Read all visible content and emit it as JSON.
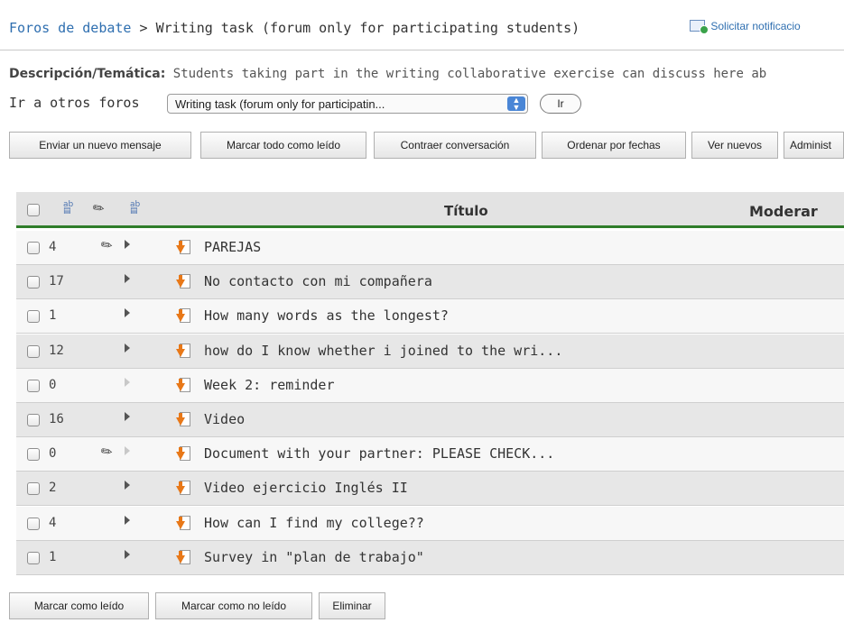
{
  "breadcrumb": {
    "forums_link": "Foros de debate",
    "separator": ">",
    "current": "Writing task (forum only for participating students)"
  },
  "notify": {
    "label": "Solicitar notificacio",
    "icon": "envelope-icon"
  },
  "description": {
    "label": "Descripción/Temática:",
    "text": "Students taking part in the writing collaborative exercise can discuss here ab"
  },
  "goto": {
    "label": "Ir a otros foros",
    "selected": "Writing task (forum only for participatin...",
    "go_button": "Ir"
  },
  "actions": [
    "Enviar un nuevo mensaje",
    "Marcar todo como leído",
    "Contraer conversación",
    "Ordenar por fechas",
    "Ver nuevos",
    "Administ"
  ],
  "table": {
    "col_title": "Título",
    "col_moderate": "Moderar",
    "rows": [
      {
        "count": "4",
        "attachment": true,
        "title": "PAREJAS",
        "arrow_active": true
      },
      {
        "count": "17",
        "attachment": false,
        "title": "No contacto con mi compañera",
        "arrow_active": true
      },
      {
        "count": "1",
        "attachment": false,
        "title": "How many words as the longest?",
        "arrow_active": true
      },
      {
        "count": "12",
        "attachment": false,
        "title": "how do I know whether i joined to the wri...",
        "arrow_active": true
      },
      {
        "count": "0",
        "attachment": false,
        "title": "Week 2: reminder",
        "arrow_active": false
      },
      {
        "count": "16",
        "attachment": false,
        "title": "Video",
        "arrow_active": true
      },
      {
        "count": "0",
        "attachment": true,
        "title": "Document with your partner: PLEASE CHECK...",
        "arrow_active": false
      },
      {
        "count": "2",
        "attachment": false,
        "title": "Video ejercicio Inglés II",
        "arrow_active": true
      },
      {
        "count": "4",
        "attachment": false,
        "title": "How can I find my college??",
        "arrow_active": true
      },
      {
        "count": "1",
        "attachment": false,
        "title": "Survey in \"plan de trabajo\"",
        "arrow_active": true
      }
    ]
  },
  "footer_actions": [
    "Marcar como leído",
    "Marcar como no leído",
    "Eliminar"
  ],
  "colors": {
    "link": "#2f6fb0",
    "header_rule": "#2f7d2a",
    "arrow_icon": "#e87818"
  }
}
